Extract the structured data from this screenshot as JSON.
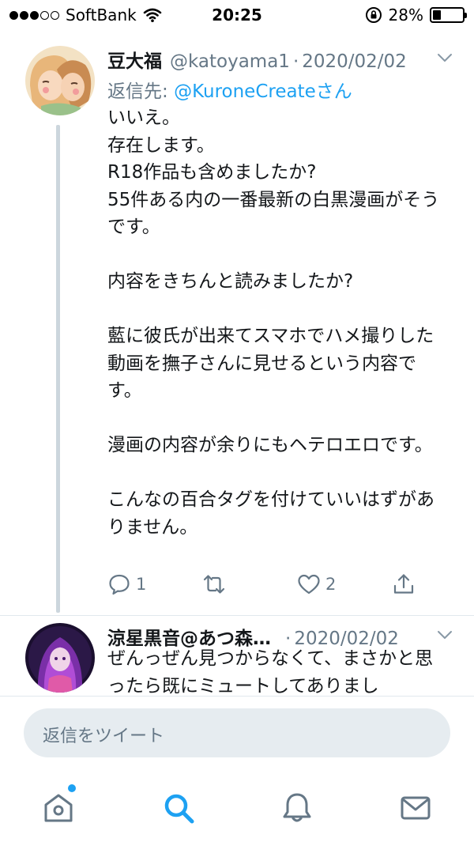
{
  "status_bar": {
    "carrier": "SoftBank",
    "time": "20:25",
    "battery_percent": "28%",
    "battery_level": 0.28,
    "signal_bars_filled": 3,
    "signal_bars_total": 5
  },
  "tweets": [
    {
      "name": "豆大福",
      "handle": "@katoyama1",
      "separator": "·",
      "date": "2020/02/02",
      "reply_to_prefix": "返信先: ",
      "reply_to_mention": "@KuroneCreateさん",
      "body": "いいえ。\n存在します。\nR18作品も含めましたか?\n55件ある内の一番最新の白黒漫画がそうです。\n\n内容をきちんと読みましたか?\n\n藍に彼氏が出来てスマホでハメ撮りした動画を撫子さんに見せるという内容です。\n\n漫画の内容が余りにもヘテロエロです。\n\nこんなの百合タグを付けていいはずがありません。",
      "reply_count": "1",
      "like_count": "2"
    },
    {
      "name": "涼星黒音@あつ森…",
      "separator": "·",
      "date": "2020/02/02",
      "body": "ぜんっぜん見つからなくて、まさかと思ったら既にミュートしてありまし"
    }
  ],
  "reply_bar": {
    "placeholder": "返信をツイート"
  },
  "colors": {
    "accent": "#1da1f2",
    "secondary_text": "#657786",
    "primary_text": "#14171a",
    "thread_line": "#ccd6dd"
  }
}
